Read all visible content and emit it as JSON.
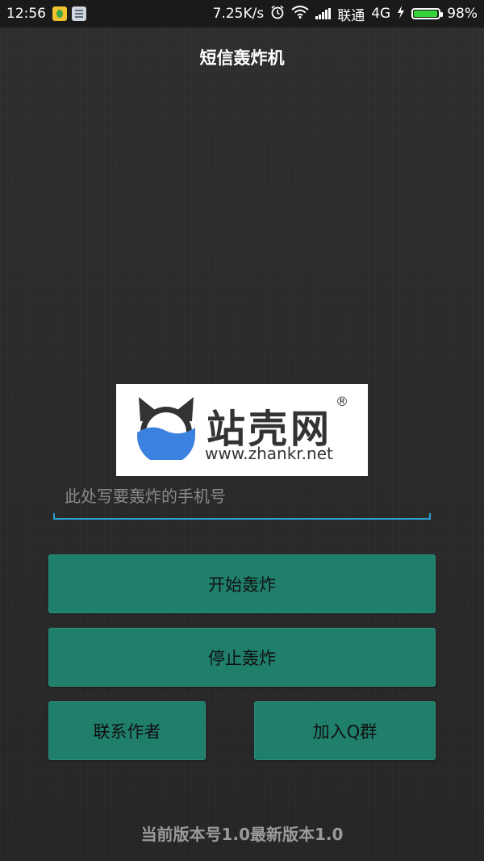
{
  "status_bar": {
    "time": "12:56",
    "speed": "7.25K/s",
    "carrier": "联通",
    "network": "4G",
    "battery": "98%",
    "battery_level": 0.98,
    "icons": [
      "app-icon",
      "notes-icon",
      "alarm-icon",
      "wifi-icon",
      "signal-icon",
      "charging-icon",
      "battery-icon"
    ]
  },
  "app": {
    "title": "短信轰炸机"
  },
  "watermark": {
    "name": "站壳网",
    "registered": "®",
    "url": "www.zhankr.net"
  },
  "phone_input": {
    "value": "",
    "placeholder": "此处写要轰炸的手机号"
  },
  "buttons": {
    "start": "开始轰炸",
    "stop": "停止轰炸",
    "contact_author": "联系作者",
    "join_qq": "加入Q群"
  },
  "footer": {
    "version_text": "当前版本号1.0最新版本1.0"
  },
  "colors": {
    "button_bg": "#1f7f6a",
    "input_underline": "#2aa0d0",
    "battery_fill": "#38d23a"
  }
}
